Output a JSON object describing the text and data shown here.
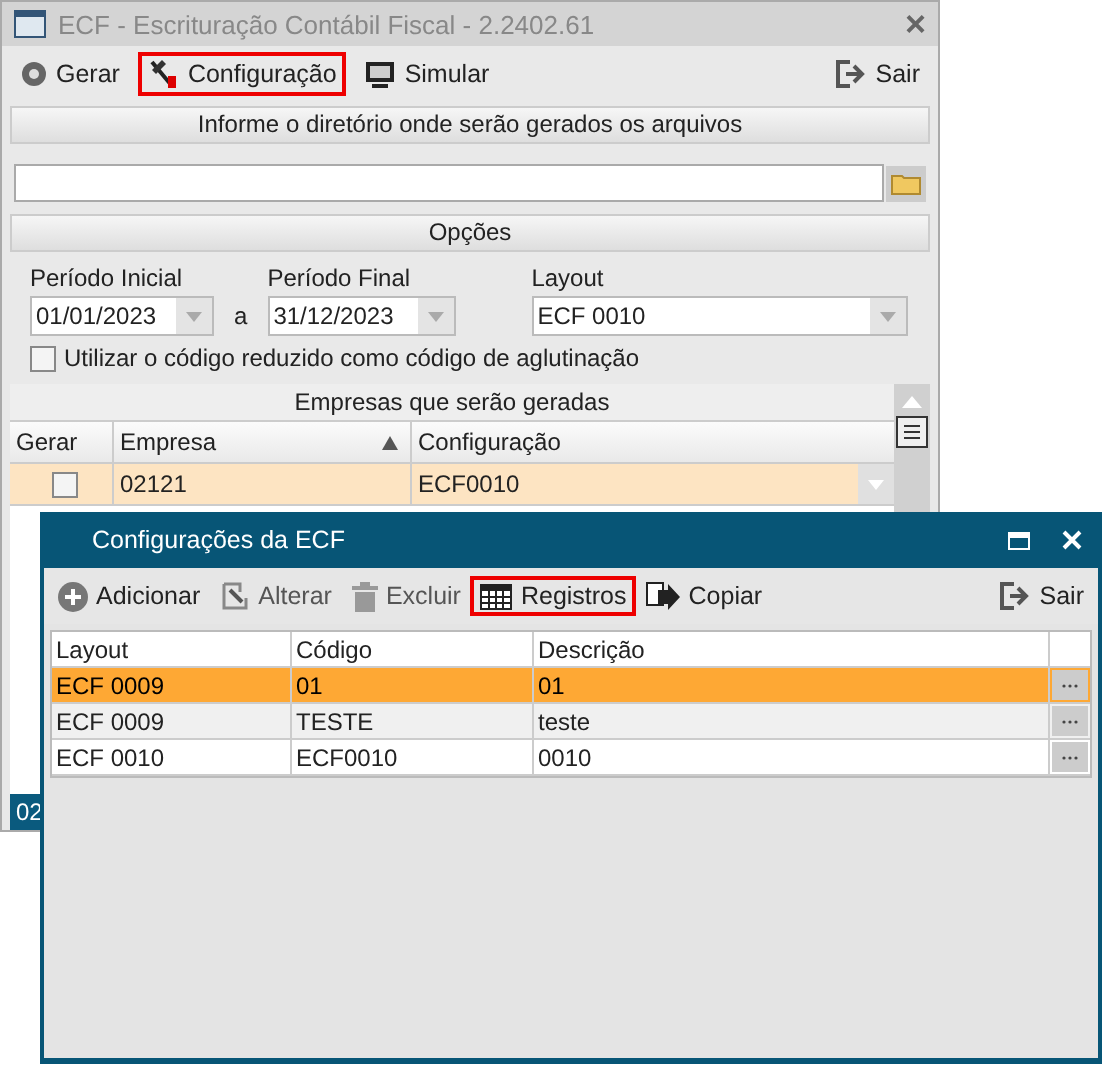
{
  "window": {
    "title": "ECF - Escrituração Contábil Fiscal - 2.2402.61",
    "close": "×"
  },
  "toolbar": [
    {
      "kind": "gerar",
      "label": "Gerar",
      "highlighted": false
    },
    {
      "kind": "config",
      "label": "Configuração",
      "highlighted": true
    },
    {
      "kind": "simular",
      "label": "Simular",
      "highlighted": false
    },
    {
      "kind": "sair",
      "label": "Sair",
      "highlighted": false
    }
  ],
  "directory": {
    "header": "Informe o diretório onde serão gerados os arquivos"
  },
  "options": {
    "header": "Opções",
    "start_label": "Período Inicial",
    "start": "01/01/2023",
    "between": "a",
    "end_label": "Período Final",
    "end": "31/12/2023",
    "layout_label": "Layout",
    "layout": "ECF 0010",
    "reduced_code": {
      "label": "Utilizar o código reduzido como código de aglutinação",
      "checked": false
    }
  },
  "companies": {
    "title": "Empresas que serão geradas",
    "columns": [
      "Gerar",
      "Empresa",
      "Configuração"
    ],
    "rows": [
      {
        "checked": false,
        "empresa": "02121",
        "configuracao": "ECF0010",
        "selected": true
      }
    ]
  },
  "status_bar": "02",
  "dialog": {
    "title": "Configurações da ECF",
    "toolbar": [
      {
        "kind": "add",
        "label": "Adicionar",
        "highlighted": false
      },
      {
        "kind": "edit",
        "label": "Alterar",
        "highlighted": false
      },
      {
        "kind": "delete",
        "label": "Excluir",
        "highlighted": false
      },
      {
        "kind": "records",
        "label": "Registros",
        "highlighted": true
      },
      {
        "kind": "copy",
        "label": "Copiar",
        "highlighted": false
      },
      {
        "kind": "exit",
        "label": "Sair",
        "highlighted": false
      }
    ],
    "columns": [
      "Layout",
      "Código",
      "Descrição"
    ],
    "rows": [
      {
        "layout": "ECF 0009",
        "codigo": "01",
        "descricao": "01",
        "selected": true
      },
      {
        "layout": "ECF 0009",
        "codigo": "TESTE",
        "descricao": "teste",
        "selected": false
      },
      {
        "layout": "ECF 0010",
        "codigo": "ECF0010",
        "descricao": "0010",
        "selected": false
      }
    ]
  }
}
